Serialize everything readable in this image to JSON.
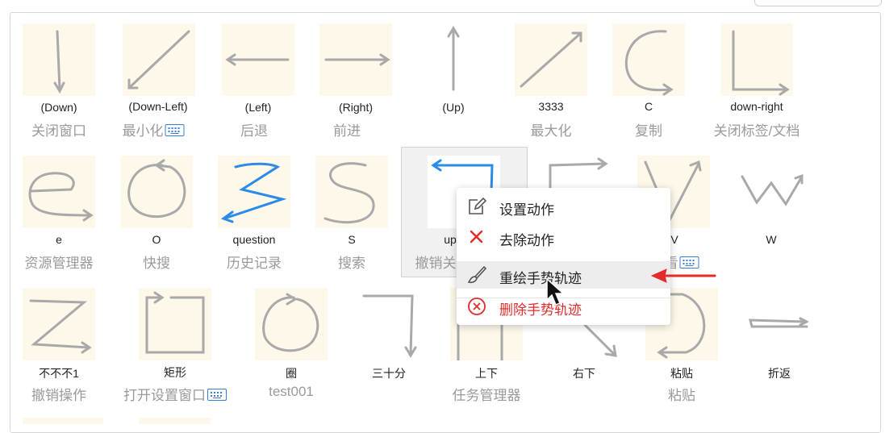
{
  "gestures": [
    {
      "name": "(Down)",
      "action": "关闭窗口",
      "kb": false
    },
    {
      "name": "(Down-Left)",
      "action": "最小化",
      "kb": true
    },
    {
      "name": "(Left)",
      "action": "后退",
      "kb": false
    },
    {
      "name": "(Right)",
      "action": "前进",
      "kb": false
    },
    {
      "name": "(Up)",
      "action": "",
      "kb": false
    },
    {
      "name": "3333",
      "action": "最大化",
      "kb": false
    },
    {
      "name": "C",
      "action": "复制",
      "kb": false
    },
    {
      "name": "down-right",
      "action": "关闭标签/文档",
      "kb": false
    },
    {
      "name": "e",
      "action": "资源管理器",
      "kb": false
    },
    {
      "name": "O",
      "action": "快搜",
      "kb": false
    },
    {
      "name": "question",
      "action": "历史记录",
      "kb": false
    },
    {
      "name": "S",
      "action": "搜索",
      "kb": false
    },
    {
      "name": "up",
      "action": "撤销关",
      "kb": false
    },
    {
      "name": "V",
      "action": "看",
      "kb": true
    },
    {
      "name": "W",
      "action": "",
      "kb": false
    },
    {
      "name": "不不不1",
      "action": "撤销操作",
      "kb": false
    },
    {
      "name": "矩形",
      "action": "打开设置窗口",
      "kb": true
    },
    {
      "name": "圈",
      "action": "test001",
      "kb": false
    },
    {
      "name": "三十分",
      "action": "",
      "kb": false
    },
    {
      "name": "上下",
      "action": "任务管理器",
      "kb": false
    },
    {
      "name": "右下",
      "action": "",
      "kb": false
    },
    {
      "name": "粘贴",
      "action": "粘贴",
      "kb": false
    },
    {
      "name": "折返",
      "action": "",
      "kb": false
    }
  ],
  "context_menu": {
    "set_action": "设置动作",
    "remove_action": "去除动作",
    "redraw": "重绘手势轨迹",
    "delete": "删除手势轨迹"
  },
  "colors": {
    "stroke_gray": "#a9a9a9",
    "stroke_blue": "#2b8be6",
    "thumb_bg": "#fdf8ea",
    "danger": "#e32b2b"
  }
}
